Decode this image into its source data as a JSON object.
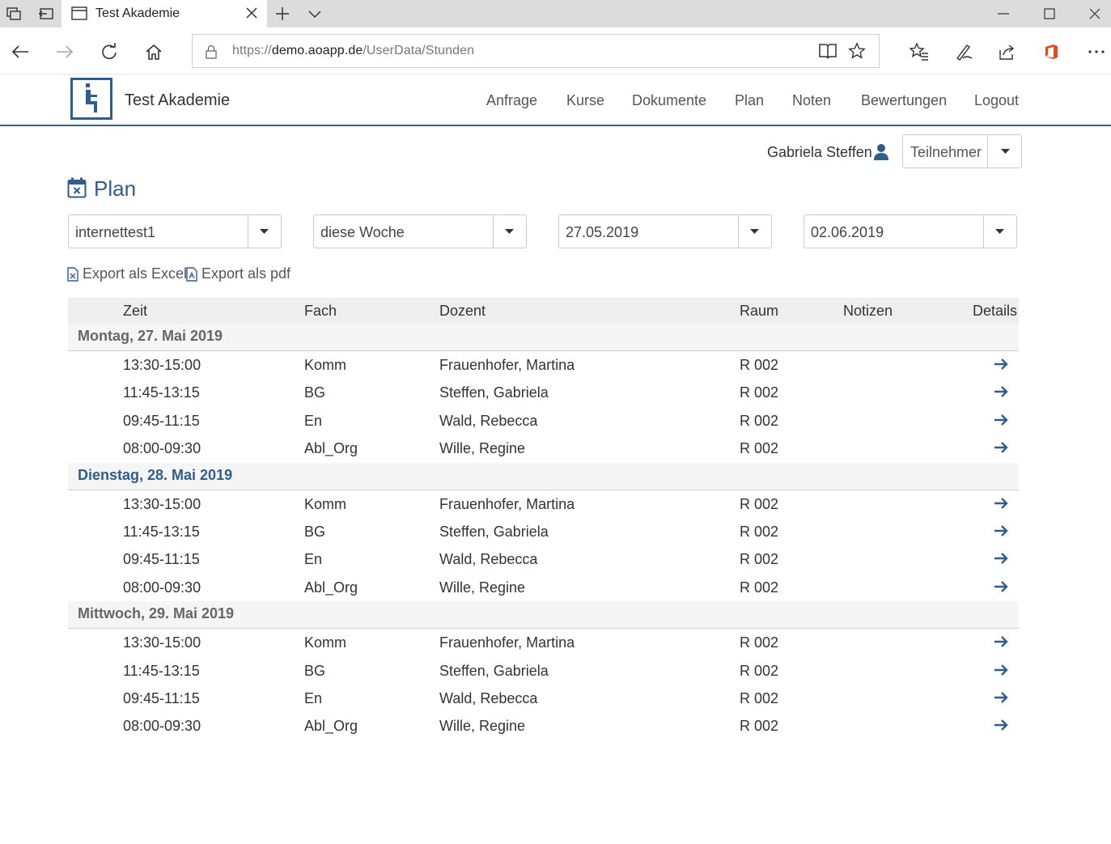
{
  "browser": {
    "tab_title": "Test Akademie",
    "url_prefix": "https://",
    "url_host": "demo.aoapp.de",
    "url_path": "/UserData/Stunden"
  },
  "site": {
    "brand": "Test Akademie",
    "nav": [
      "Anfrage",
      "Kurse",
      "Dokumente",
      "Plan",
      "Noten",
      "Bewertungen",
      "Logout"
    ]
  },
  "user": {
    "name": "Gabriela Steffen",
    "role": "Teilnehmer"
  },
  "page": {
    "title": "Plan",
    "filters": {
      "group": "internettest1",
      "period": "diese Woche",
      "date_from": "27.05.2019",
      "date_to": "02.06.2019"
    },
    "export_excel": "Export als Excel",
    "export_pdf": "Export als pdf"
  },
  "table": {
    "headers": {
      "zeit": "Zeit",
      "fach": "Fach",
      "dozent": "Dozent",
      "raum": "Raum",
      "notizen": "Notizen",
      "details": "Details"
    },
    "days": [
      {
        "label": "Montag, 27. Mai 2019",
        "rows": [
          {
            "zeit": "13:30-15:00",
            "fach": "Komm",
            "dozent": "Frauenhofer, Martina",
            "raum": "R 002",
            "notizen": ""
          },
          {
            "zeit": "11:45-13:15",
            "fach": "BG",
            "dozent": "Steffen, Gabriela",
            "raum": "R 002",
            "notizen": ""
          },
          {
            "zeit": "09:45-11:15",
            "fach": "En",
            "dozent": "Wald, Rebecca",
            "raum": "R 002",
            "notizen": ""
          },
          {
            "zeit": "08:00-09:30",
            "fach": "Abl_Org",
            "dozent": "Wille, Regine",
            "raum": "R 002",
            "notizen": ""
          }
        ]
      },
      {
        "label": "Dienstag, 28. Mai 2019",
        "rows": [
          {
            "zeit": "13:30-15:00",
            "fach": "Komm",
            "dozent": "Frauenhofer, Martina",
            "raum": "R 002",
            "notizen": ""
          },
          {
            "zeit": "11:45-13:15",
            "fach": "BG",
            "dozent": "Steffen, Gabriela",
            "raum": "R 002",
            "notizen": ""
          },
          {
            "zeit": "09:45-11:15",
            "fach": "En",
            "dozent": "Wald, Rebecca",
            "raum": "R 002",
            "notizen": ""
          },
          {
            "zeit": "08:00-09:30",
            "fach": "Abl_Org",
            "dozent": "Wille, Regine",
            "raum": "R 002",
            "notizen": ""
          }
        ]
      },
      {
        "label": "Mittwoch, 29. Mai 2019",
        "rows": [
          {
            "zeit": "13:30-15:00",
            "fach": "Komm",
            "dozent": "Frauenhofer, Martina",
            "raum": "R 002",
            "notizen": ""
          },
          {
            "zeit": "11:45-13:15",
            "fach": "BG",
            "dozent": "Steffen, Gabriela",
            "raum": "R 002",
            "notizen": ""
          },
          {
            "zeit": "09:45-11:15",
            "fach": "En",
            "dozent": "Wald, Rebecca",
            "raum": "R 002",
            "notizen": ""
          },
          {
            "zeit": "08:00-09:30",
            "fach": "Abl_Org",
            "dozent": "Wille, Regine",
            "raum": "R 002",
            "notizen": ""
          }
        ]
      }
    ]
  },
  "colors": {
    "accent": "#2f5d8c",
    "office": "#e64a19"
  }
}
